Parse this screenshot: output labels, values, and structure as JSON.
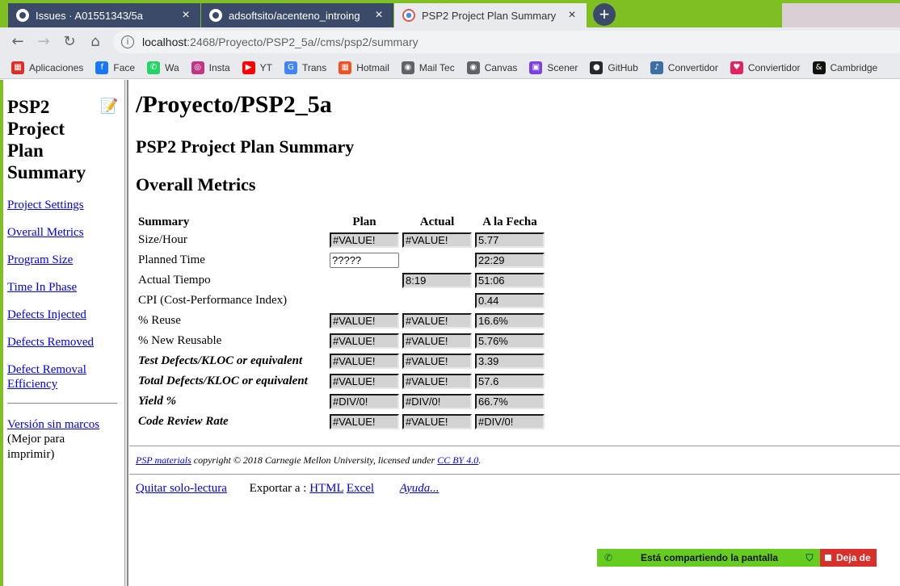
{
  "browser": {
    "tabs": [
      {
        "title": "Issues · A01551343/5a",
        "close": "×"
      },
      {
        "title": "adsoftsito/acenteno_introing",
        "close": "×"
      },
      {
        "title": "PSP2 Project Plan Summary",
        "close": "×"
      }
    ],
    "new_tab": "+",
    "nav": {
      "back": "←",
      "forward": "→",
      "reload": "↻",
      "home": "⌂"
    },
    "address": {
      "info": "i",
      "host": "localhost",
      "path": ":2468/Proyecto/PSP2_5a//cms/psp2/summary"
    },
    "bookmarks": [
      {
        "label": "Aplicaciones",
        "icon": "apps-grid-icon",
        "color": "#d93025"
      },
      {
        "label": "Face",
        "icon": "facebook-icon",
        "color": "#1877f2"
      },
      {
        "label": "Wa",
        "icon": "whatsapp-icon",
        "color": "#25d366"
      },
      {
        "label": "Insta",
        "icon": "instagram-icon",
        "color": "#c13584"
      },
      {
        "label": "YT",
        "icon": "youtube-icon",
        "color": "#ff0000"
      },
      {
        "label": "Trans",
        "icon": "translate-icon",
        "color": "#4285f4"
      },
      {
        "label": "Hotmail",
        "icon": "microsoft-icon",
        "color": "#f25022"
      },
      {
        "label": "Mail Tec",
        "icon": "globe-icon",
        "color": "#5f6368"
      },
      {
        "label": "Canvas",
        "icon": "globe-icon",
        "color": "#5f6368"
      },
      {
        "label": "Scener",
        "icon": "scener-icon",
        "color": "#7b3fe4"
      },
      {
        "label": "GitHub",
        "icon": "github-icon",
        "color": "#24292e"
      },
      {
        "label": "Convertidor",
        "icon": "ytmp3-icon",
        "color": "#3a6ea5"
      },
      {
        "label": "Conviertidor",
        "icon": "heart-icon",
        "color": "#e0245e"
      },
      {
        "label": "Cambridge",
        "icon": "ampersand-icon",
        "color": "#111111"
      }
    ]
  },
  "sidebar": {
    "title": "PSP2 Project Plan Summary",
    "links": [
      "Project Settings",
      "Overall Metrics",
      "Program Size",
      "Time In Phase",
      "Defects Injected",
      "Defects Removed",
      "Defect Removal Efficiency"
    ],
    "frameless_link": "Versión sin marcos",
    "frameless_note": "(Mejor para imprimir)"
  },
  "main": {
    "path_title": "/Proyecto/PSP2_5a",
    "subtitle": "PSP2 Project Plan Summary",
    "section_title": "Overall Metrics",
    "table": {
      "headers": [
        "Summary",
        "Plan",
        "Actual",
        "A la Fecha"
      ],
      "rows": [
        {
          "label": "Size/Hour",
          "plan": "#VALUE!",
          "actual": "#VALUE!",
          "to_date": "5.77"
        },
        {
          "label": "Planned Time",
          "plan": "?????",
          "actual": "",
          "to_date": "22:29"
        },
        {
          "label": "Actual Tiempo",
          "plan": "",
          "actual": "8:19",
          "to_date": "51:06"
        },
        {
          "label": "CPI (Cost-Performance Index)",
          "plan": "",
          "actual": "",
          "to_date": "0.44"
        },
        {
          "label": "% Reuse",
          "plan": "#VALUE!",
          "actual": "#VALUE!",
          "to_date": "16.6%"
        },
        {
          "label": "% New Reusable",
          "plan": "#VALUE!",
          "actual": "#VALUE!",
          "to_date": "5.76%"
        },
        {
          "label": "Test Defects/KLOC or equivalent",
          "plan": "#VALUE!",
          "actual": "#VALUE!",
          "to_date": "3.39"
        },
        {
          "label": "Total Defects/KLOC or equivalent",
          "plan": "#VALUE!",
          "actual": "#VALUE!",
          "to_date": "57.6"
        },
        {
          "label": "Yield %",
          "plan": "#DIV/0!",
          "actual": "#DIV/0!",
          "to_date": "66.7%"
        },
        {
          "label": "Code Review Rate",
          "plan": "#VALUE!",
          "actual": "#VALUE!",
          "to_date": "#DIV/0!"
        }
      ]
    },
    "copyright": {
      "link1": "PSP materials",
      "text1": " copyright © 2018 Carnegie Mellon University, licensed under ",
      "link2": "CC BY 4.0",
      "text2": "."
    },
    "actions": {
      "readonly": "Quitar solo-lectura",
      "export_label": "Exportar a : ",
      "html": "HTML",
      "excel": "Excel",
      "help": "Ayuda..."
    }
  },
  "sharebar": {
    "message": "Está compartiendo la pantalla",
    "stop": "Deja de"
  }
}
